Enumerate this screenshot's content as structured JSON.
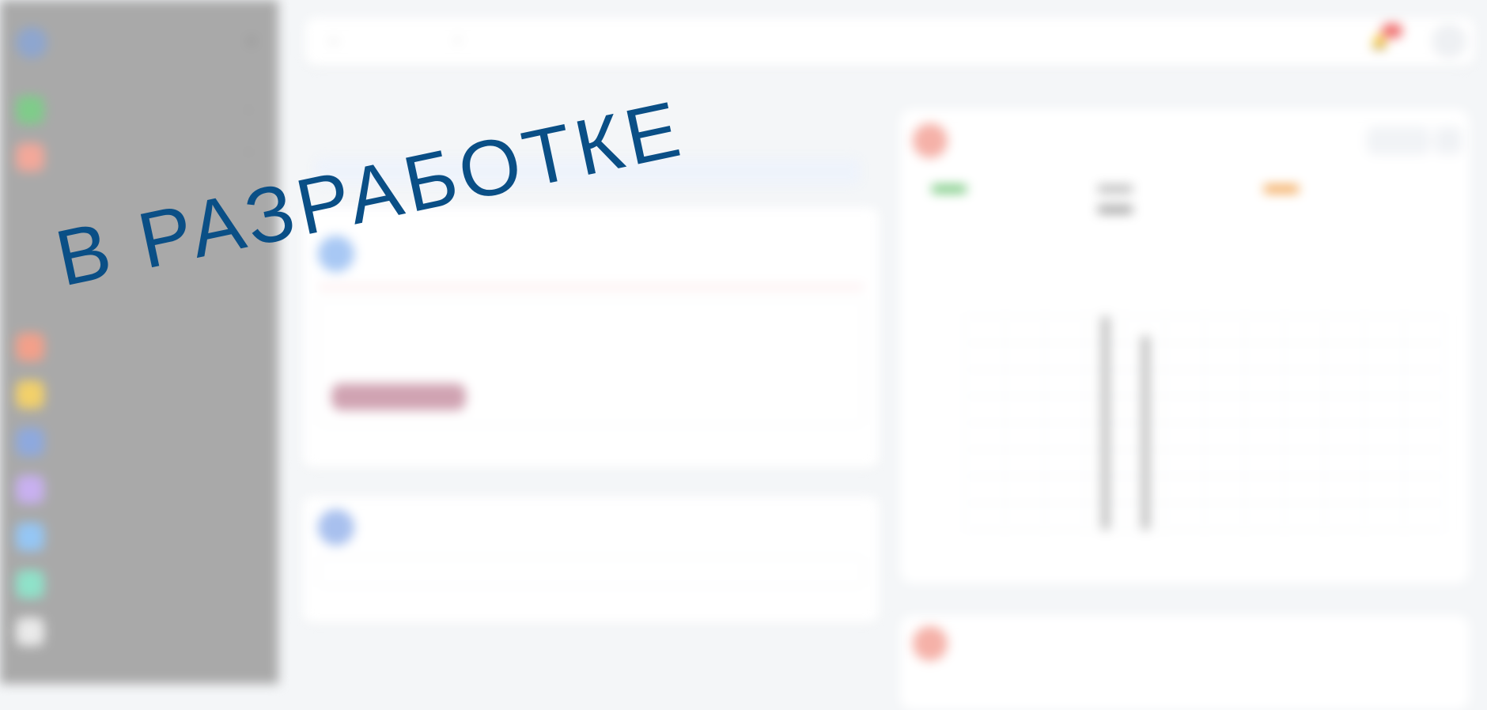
{
  "overlay": {
    "text": "В РАЗРАБОТКЕ",
    "color": "#0a4f86"
  },
  "sidebar": {
    "brand_title": "",
    "brand_subtitle": "",
    "items": [
      {
        "label": "",
        "icon": "grid-icon",
        "color": "#7fcc8a"
      },
      {
        "label": "",
        "icon": "briefcase-icon",
        "color": "#f3a89a"
      },
      {
        "label": "",
        "icon": "users-icon",
        "color": "#f3a08a"
      },
      {
        "label": "",
        "icon": "star-icon",
        "color": "#f2d06a"
      },
      {
        "label": "",
        "icon": "mail-icon",
        "color": "#8ea9de"
      },
      {
        "label": "",
        "icon": "calendar-icon",
        "color": "#c8b0f0"
      },
      {
        "label": "",
        "icon": "book-icon",
        "color": "#95c6f4"
      },
      {
        "label": "",
        "icon": "chart-icon",
        "color": "#8fe2c9"
      },
      {
        "label": "",
        "icon": "gear-icon",
        "color": "#eaeaea"
      }
    ],
    "subitems": [
      "",
      "",
      ""
    ]
  },
  "topbar": {
    "back_label": "",
    "search_label": "",
    "notifications_badge": ""
  },
  "left_panel": {
    "title": "",
    "card1_title": "",
    "card1_subtitle": "",
    "detail_line1": "",
    "detail_line2": "",
    "status_label": "",
    "priority_label": "",
    "deadline_label": "",
    "status_value": "",
    "priority_value": "",
    "deadline_value": "",
    "card2_title": "",
    "card2_subtitle": "",
    "card2_input_placeholder": ""
  },
  "right_card": {
    "title": "",
    "subtitle": "",
    "button_label": ""
  },
  "chart_data": {
    "type": "bar",
    "categories": [
      "",
      "",
      "",
      "",
      "",
      "",
      "",
      "",
      "",
      "",
      "",
      ""
    ],
    "values": [
      0,
      0,
      0,
      100,
      91,
      0,
      0,
      0,
      0,
      0,
      0,
      0
    ],
    "ylim": [
      0,
      100
    ],
    "legend": [
      {
        "label": "",
        "color": "#6cc474"
      },
      {
        "label": "",
        "color": "#b8b8b8"
      },
      {
        "label": "",
        "color": "#f2a24d"
      },
      {
        "label": "",
        "color": "#9c9c9c"
      }
    ],
    "grid": true
  },
  "right_card_2": {
    "title": "",
    "subtitle": ""
  }
}
